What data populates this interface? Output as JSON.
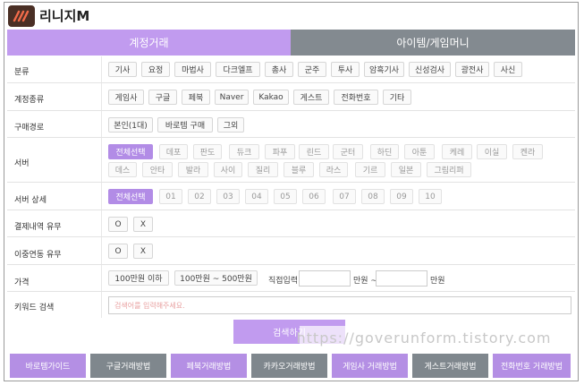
{
  "app": {
    "title": "리니지M"
  },
  "tabs": [
    {
      "label": "계정거래"
    },
    {
      "label": "아이템/게임머니"
    }
  ],
  "filters": {
    "category": {
      "label": "분류",
      "options": [
        "기사",
        "요정",
        "마법사",
        "다크엘프",
        "총사",
        "군주",
        "투사",
        "암흑기사",
        "신성검사",
        "광전사",
        "사신"
      ]
    },
    "account_type": {
      "label": "계정종류",
      "options": [
        "게임사",
        "구글",
        "페북",
        "Naver",
        "Kakao",
        "게스트",
        "전화번호",
        "기타"
      ]
    },
    "purchase_route": {
      "label": "구매경로",
      "options": [
        "본인(1대)",
        "바로템 구매",
        "그외"
      ]
    },
    "server": {
      "label": "서버",
      "options": [
        "전체선택",
        "데포",
        "판도",
        "듀크",
        "파푸",
        "린드",
        "군터",
        "하딘",
        "아툰",
        "케레",
        "이실",
        "켄라",
        "데스",
        "안타",
        "발라",
        "사이",
        "질리",
        "블루",
        "라스",
        "기르",
        "일본",
        "그림리퍼"
      ]
    },
    "server_detail": {
      "label": "서버 상세",
      "options": [
        "전체선택",
        "01",
        "02",
        "03",
        "04",
        "05",
        "06",
        "07",
        "08",
        "09",
        "10"
      ]
    },
    "payment_history": {
      "label": "결제내역 유무",
      "options": [
        "O",
        "X"
      ]
    },
    "dual_link": {
      "label": "이중연동 유무",
      "options": [
        "O",
        "X"
      ]
    },
    "price": {
      "label": "가격",
      "options": [
        "100만원 이하",
        "100만원 ~ 500만원"
      ],
      "direct_label": "직접입력",
      "unit_from": "만원 ~",
      "unit_to": "만원"
    },
    "keyword": {
      "label": "키워드 검색",
      "placeholder": "검색어를 입력해주세요."
    }
  },
  "search_button": "검색하기",
  "watermark": "https://goverunform.tistory.com",
  "guides": [
    {
      "label": "바로템가이드",
      "color": "purple"
    },
    {
      "label": "구글거래방법",
      "color": "gray"
    },
    {
      "label": "페북거래방법",
      "color": "purple"
    },
    {
      "label": "카카오거래방법",
      "color": "gray"
    },
    {
      "label": "게임사 거래방법",
      "color": "purple"
    },
    {
      "label": "게스트거래방법",
      "color": "gray"
    },
    {
      "label": "전화번호 거래방법",
      "color": "purple"
    }
  ],
  "colors": {
    "accent": "#c19bef",
    "selected": "#b28ce6",
    "inactive_tab": "#838a90",
    "placeholder": "#e8a0a0"
  }
}
